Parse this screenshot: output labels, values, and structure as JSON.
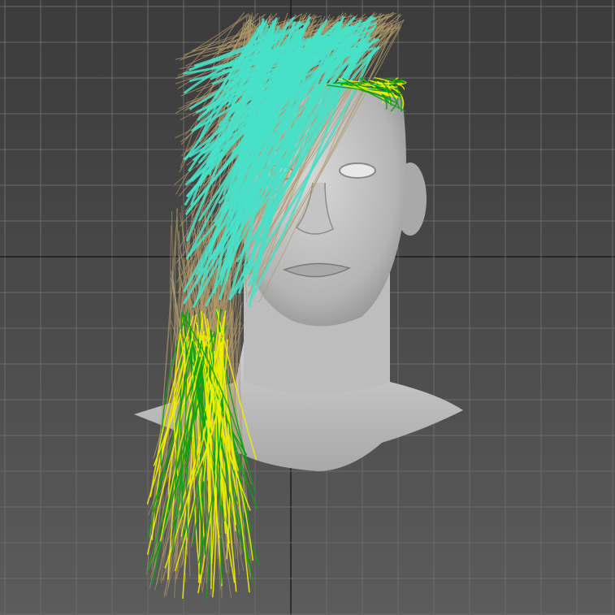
{
  "viewport": {
    "grid_color": "#6a6a6a",
    "axis_color": "#1e1e1e",
    "model_color": "#c8c8c8",
    "hair_colors": {
      "base": "#b09a6a",
      "guides_top": "#48e0c8",
      "guides_yellow": "#f0f000",
      "guides_green": "#10a010"
    }
  }
}
